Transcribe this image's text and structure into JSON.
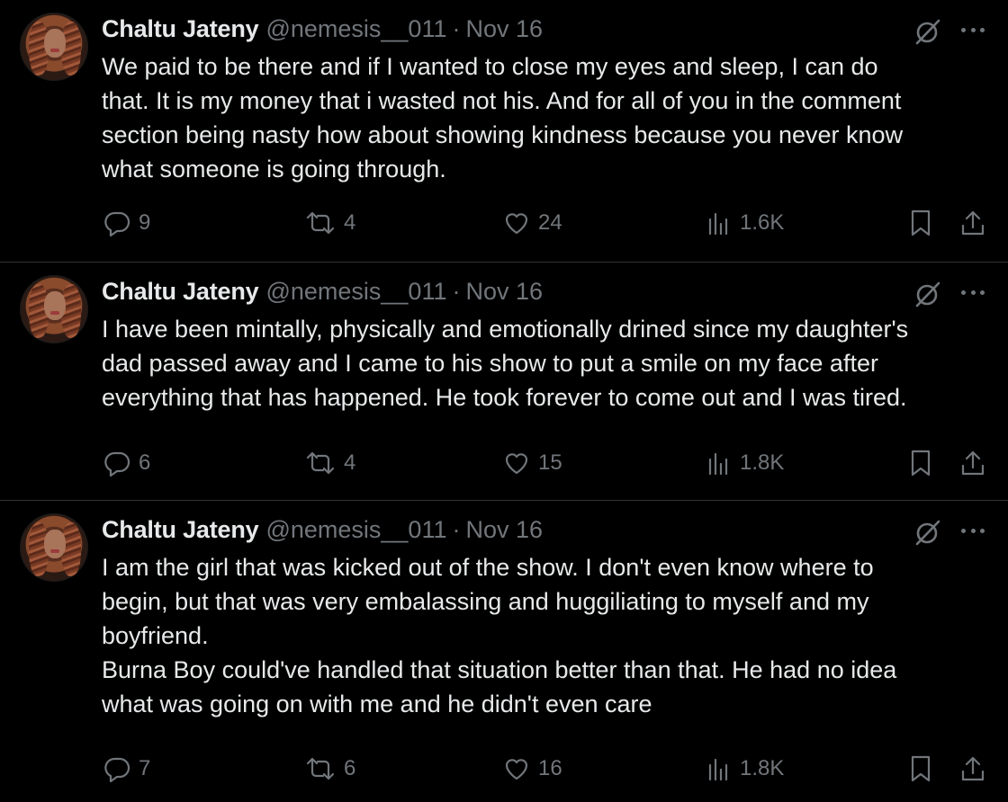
{
  "tweets": [
    {
      "author_name": "Chaltu Jateny",
      "handle": "@nemesis__011",
      "separator": "·",
      "date": "Nov 16",
      "text": "We paid to be there and if I wanted to close my eyes and sleep, I can do\nthat. It is my money that i wasted not his. And for all of you in the comment\nsection being nasty how about showing kindness because you never know\nwhat someone is going through.",
      "replies": "9",
      "retweets": "4",
      "likes": "24",
      "views": "1.6K"
    },
    {
      "author_name": "Chaltu Jateny",
      "handle": "@nemesis__011",
      "separator": "·",
      "date": "Nov 16",
      "text": "I have been mintally, physically and emotionally drined since my daughter's\ndad passed away and I came to his show to put a smile on my face after\neverything that has happened. He took forever to come out and I was tired.",
      "replies": "6",
      "retweets": "4",
      "likes": "15",
      "views": "1.8K"
    },
    {
      "author_name": "Chaltu Jateny",
      "handle": "@nemesis__011",
      "separator": "·",
      "date": "Nov 16",
      "text": "I am the girl that was kicked out of the show. I don't even know where to\nbegin, but that was very embalassing and huggiliating to myself and my\nboyfriend.\nBurna Boy could've handled that situation better than that. He had no idea\nwhat was going on with me and he didn't even care",
      "replies": "7",
      "retweets": "6",
      "likes": "16",
      "views": "1.8K"
    }
  ],
  "icons": {
    "reply": "reply-icon",
    "retweet": "retweet-icon",
    "like": "heart-icon",
    "views": "views-icon",
    "bookmark": "bookmark-icon",
    "share": "share-icon",
    "grok": "grok-icon",
    "more": "more-icon"
  },
  "colors": {
    "background": "#000000",
    "text": "#e7e9ea",
    "secondary": "#71767b",
    "divider": "#2f3336"
  }
}
